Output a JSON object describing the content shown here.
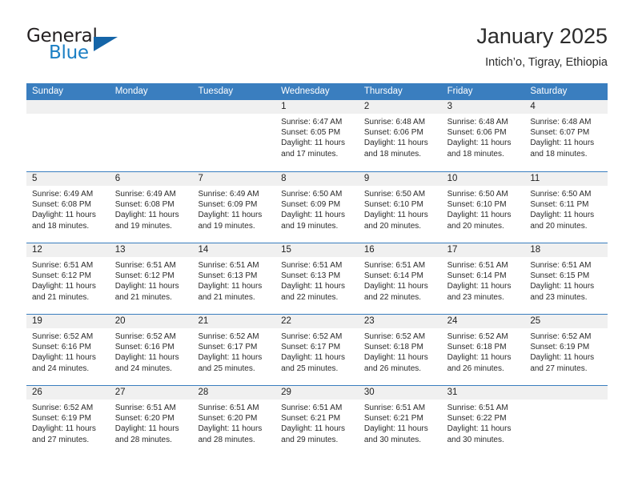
{
  "brand": {
    "name_part1": "General",
    "name_part2": "Blue",
    "logo_icon": "triangle-logo-icon"
  },
  "header": {
    "title": "January 2025",
    "location": "Intich’o, Tigray, Ethiopia"
  },
  "colors": {
    "header_blue": "#3a7ebf",
    "brand_blue": "#1b7fc4",
    "day_band_gray": "#f0f0f0",
    "text": "#2a2a2a"
  },
  "weekdays": [
    "Sunday",
    "Monday",
    "Tuesday",
    "Wednesday",
    "Thursday",
    "Friday",
    "Saturday"
  ],
  "weeks": [
    [
      {
        "day": "",
        "empty": true,
        "sunrise": "",
        "sunset": "",
        "daylight1": "",
        "daylight2": ""
      },
      {
        "day": "",
        "empty": true,
        "sunrise": "",
        "sunset": "",
        "daylight1": "",
        "daylight2": ""
      },
      {
        "day": "",
        "empty": true,
        "sunrise": "",
        "sunset": "",
        "daylight1": "",
        "daylight2": ""
      },
      {
        "day": "1",
        "empty": false,
        "sunrise": "Sunrise: 6:47 AM",
        "sunset": "Sunset: 6:05 PM",
        "daylight1": "Daylight: 11 hours",
        "daylight2": "and 17 minutes."
      },
      {
        "day": "2",
        "empty": false,
        "sunrise": "Sunrise: 6:48 AM",
        "sunset": "Sunset: 6:06 PM",
        "daylight1": "Daylight: 11 hours",
        "daylight2": "and 18 minutes."
      },
      {
        "day": "3",
        "empty": false,
        "sunrise": "Sunrise: 6:48 AM",
        "sunset": "Sunset: 6:06 PM",
        "daylight1": "Daylight: 11 hours",
        "daylight2": "and 18 minutes."
      },
      {
        "day": "4",
        "empty": false,
        "sunrise": "Sunrise: 6:48 AM",
        "sunset": "Sunset: 6:07 PM",
        "daylight1": "Daylight: 11 hours",
        "daylight2": "and 18 minutes."
      }
    ],
    [
      {
        "day": "5",
        "empty": false,
        "sunrise": "Sunrise: 6:49 AM",
        "sunset": "Sunset: 6:08 PM",
        "daylight1": "Daylight: 11 hours",
        "daylight2": "and 18 minutes."
      },
      {
        "day": "6",
        "empty": false,
        "sunrise": "Sunrise: 6:49 AM",
        "sunset": "Sunset: 6:08 PM",
        "daylight1": "Daylight: 11 hours",
        "daylight2": "and 19 minutes."
      },
      {
        "day": "7",
        "empty": false,
        "sunrise": "Sunrise: 6:49 AM",
        "sunset": "Sunset: 6:09 PM",
        "daylight1": "Daylight: 11 hours",
        "daylight2": "and 19 minutes."
      },
      {
        "day": "8",
        "empty": false,
        "sunrise": "Sunrise: 6:50 AM",
        "sunset": "Sunset: 6:09 PM",
        "daylight1": "Daylight: 11 hours",
        "daylight2": "and 19 minutes."
      },
      {
        "day": "9",
        "empty": false,
        "sunrise": "Sunrise: 6:50 AM",
        "sunset": "Sunset: 6:10 PM",
        "daylight1": "Daylight: 11 hours",
        "daylight2": "and 20 minutes."
      },
      {
        "day": "10",
        "empty": false,
        "sunrise": "Sunrise: 6:50 AM",
        "sunset": "Sunset: 6:10 PM",
        "daylight1": "Daylight: 11 hours",
        "daylight2": "and 20 minutes."
      },
      {
        "day": "11",
        "empty": false,
        "sunrise": "Sunrise: 6:50 AM",
        "sunset": "Sunset: 6:11 PM",
        "daylight1": "Daylight: 11 hours",
        "daylight2": "and 20 minutes."
      }
    ],
    [
      {
        "day": "12",
        "empty": false,
        "sunrise": "Sunrise: 6:51 AM",
        "sunset": "Sunset: 6:12 PM",
        "daylight1": "Daylight: 11 hours",
        "daylight2": "and 21 minutes."
      },
      {
        "day": "13",
        "empty": false,
        "sunrise": "Sunrise: 6:51 AM",
        "sunset": "Sunset: 6:12 PM",
        "daylight1": "Daylight: 11 hours",
        "daylight2": "and 21 minutes."
      },
      {
        "day": "14",
        "empty": false,
        "sunrise": "Sunrise: 6:51 AM",
        "sunset": "Sunset: 6:13 PM",
        "daylight1": "Daylight: 11 hours",
        "daylight2": "and 21 minutes."
      },
      {
        "day": "15",
        "empty": false,
        "sunrise": "Sunrise: 6:51 AM",
        "sunset": "Sunset: 6:13 PM",
        "daylight1": "Daylight: 11 hours",
        "daylight2": "and 22 minutes."
      },
      {
        "day": "16",
        "empty": false,
        "sunrise": "Sunrise: 6:51 AM",
        "sunset": "Sunset: 6:14 PM",
        "daylight1": "Daylight: 11 hours",
        "daylight2": "and 22 minutes."
      },
      {
        "day": "17",
        "empty": false,
        "sunrise": "Sunrise: 6:51 AM",
        "sunset": "Sunset: 6:14 PM",
        "daylight1": "Daylight: 11 hours",
        "daylight2": "and 23 minutes."
      },
      {
        "day": "18",
        "empty": false,
        "sunrise": "Sunrise: 6:51 AM",
        "sunset": "Sunset: 6:15 PM",
        "daylight1": "Daylight: 11 hours",
        "daylight2": "and 23 minutes."
      }
    ],
    [
      {
        "day": "19",
        "empty": false,
        "sunrise": "Sunrise: 6:52 AM",
        "sunset": "Sunset: 6:16 PM",
        "daylight1": "Daylight: 11 hours",
        "daylight2": "and 24 minutes."
      },
      {
        "day": "20",
        "empty": false,
        "sunrise": "Sunrise: 6:52 AM",
        "sunset": "Sunset: 6:16 PM",
        "daylight1": "Daylight: 11 hours",
        "daylight2": "and 24 minutes."
      },
      {
        "day": "21",
        "empty": false,
        "sunrise": "Sunrise: 6:52 AM",
        "sunset": "Sunset: 6:17 PM",
        "daylight1": "Daylight: 11 hours",
        "daylight2": "and 25 minutes."
      },
      {
        "day": "22",
        "empty": false,
        "sunrise": "Sunrise: 6:52 AM",
        "sunset": "Sunset: 6:17 PM",
        "daylight1": "Daylight: 11 hours",
        "daylight2": "and 25 minutes."
      },
      {
        "day": "23",
        "empty": false,
        "sunrise": "Sunrise: 6:52 AM",
        "sunset": "Sunset: 6:18 PM",
        "daylight1": "Daylight: 11 hours",
        "daylight2": "and 26 minutes."
      },
      {
        "day": "24",
        "empty": false,
        "sunrise": "Sunrise: 6:52 AM",
        "sunset": "Sunset: 6:18 PM",
        "daylight1": "Daylight: 11 hours",
        "daylight2": "and 26 minutes."
      },
      {
        "day": "25",
        "empty": false,
        "sunrise": "Sunrise: 6:52 AM",
        "sunset": "Sunset: 6:19 PM",
        "daylight1": "Daylight: 11 hours",
        "daylight2": "and 27 minutes."
      }
    ],
    [
      {
        "day": "26",
        "empty": false,
        "sunrise": "Sunrise: 6:52 AM",
        "sunset": "Sunset: 6:19 PM",
        "daylight1": "Daylight: 11 hours",
        "daylight2": "and 27 minutes."
      },
      {
        "day": "27",
        "empty": false,
        "sunrise": "Sunrise: 6:51 AM",
        "sunset": "Sunset: 6:20 PM",
        "daylight1": "Daylight: 11 hours",
        "daylight2": "and 28 minutes."
      },
      {
        "day": "28",
        "empty": false,
        "sunrise": "Sunrise: 6:51 AM",
        "sunset": "Sunset: 6:20 PM",
        "daylight1": "Daylight: 11 hours",
        "daylight2": "and 28 minutes."
      },
      {
        "day": "29",
        "empty": false,
        "sunrise": "Sunrise: 6:51 AM",
        "sunset": "Sunset: 6:21 PM",
        "daylight1": "Daylight: 11 hours",
        "daylight2": "and 29 minutes."
      },
      {
        "day": "30",
        "empty": false,
        "sunrise": "Sunrise: 6:51 AM",
        "sunset": "Sunset: 6:21 PM",
        "daylight1": "Daylight: 11 hours",
        "daylight2": "and 30 minutes."
      },
      {
        "day": "31",
        "empty": false,
        "sunrise": "Sunrise: 6:51 AM",
        "sunset": "Sunset: 6:22 PM",
        "daylight1": "Daylight: 11 hours",
        "daylight2": "and 30 minutes."
      },
      {
        "day": "",
        "empty": true,
        "sunrise": "",
        "sunset": "",
        "daylight1": "",
        "daylight2": ""
      }
    ]
  ]
}
